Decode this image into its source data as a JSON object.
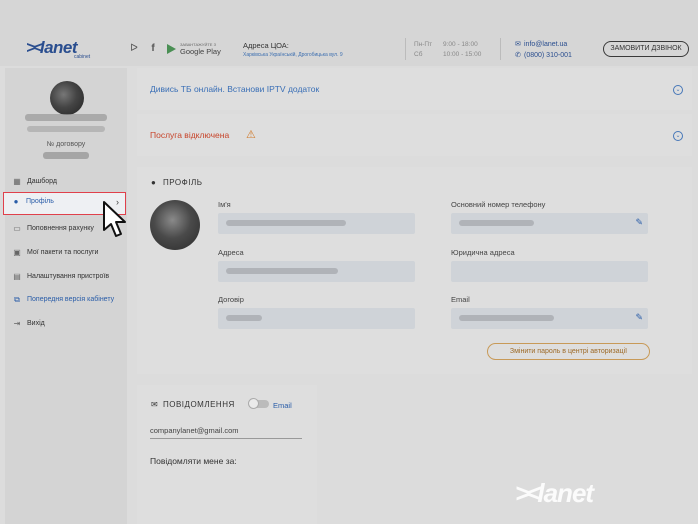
{
  "header": {
    "logo_text": "lanet",
    "logo_sub": "cabinet",
    "google_play_small": "ЗАВАНТАЖУЙТЕ З",
    "google_play_big": "Google Play",
    "address_label": "Адреса ЦОА:",
    "address_link": "Харківська Українській, Дрогобицька вул. 9",
    "schedule": [
      {
        "days": "Пн-Пт",
        "hours": "9:00 - 18:00"
      },
      {
        "days": "Сб",
        "hours": "10:00 - 15:00"
      }
    ],
    "email": "info@lanet.ua",
    "phone": "(0800) 310-001",
    "call_button": "ЗАМОВИТИ ДЗВІНОК"
  },
  "sidebar": {
    "contract_label": "№ договору",
    "items": [
      {
        "label": "Дашборд",
        "icon": "dashboard-icon"
      },
      {
        "label": "Профіль",
        "icon": "user-icon"
      },
      {
        "label": "Поповнення рахунку",
        "icon": "wallet-icon"
      },
      {
        "label": "Мої пакети та послуги",
        "icon": "box-icon"
      },
      {
        "label": "Налаштування пристроїв",
        "icon": "router-icon"
      },
      {
        "label": "Попередня версія кабінету",
        "icon": "external-link-icon"
      },
      {
        "label": "Вихід",
        "icon": "logout-icon"
      }
    ]
  },
  "banners": [
    {
      "text": "Дивись ТБ онлайн. Встанови IPTV додаток"
    },
    {
      "text": "Послуга відключена"
    }
  ],
  "profile": {
    "title": "ПРОФІЛЬ",
    "fields": {
      "name_label": "Ім'я",
      "phone_label": "Основний номер телефону",
      "address_label": "Адреса",
      "legal_address_label": "Юридична адреса",
      "contract_label": "Договір",
      "email_label": "Email"
    },
    "change_password_button": "Змінити пароль в центрі авторизації"
  },
  "notifications": {
    "title": "ПОВІДОМЛЕННЯ",
    "email_toggle_label": "Email",
    "email_value": "companylanet@gmail.com",
    "notify_by_label": "Повідомляти мене за:"
  },
  "watermark": "lanet",
  "colors": {
    "accent_blue": "#2a5da8",
    "active_border": "#e0404b",
    "warning": "#c7442a",
    "button_outline": "#c89a58"
  }
}
